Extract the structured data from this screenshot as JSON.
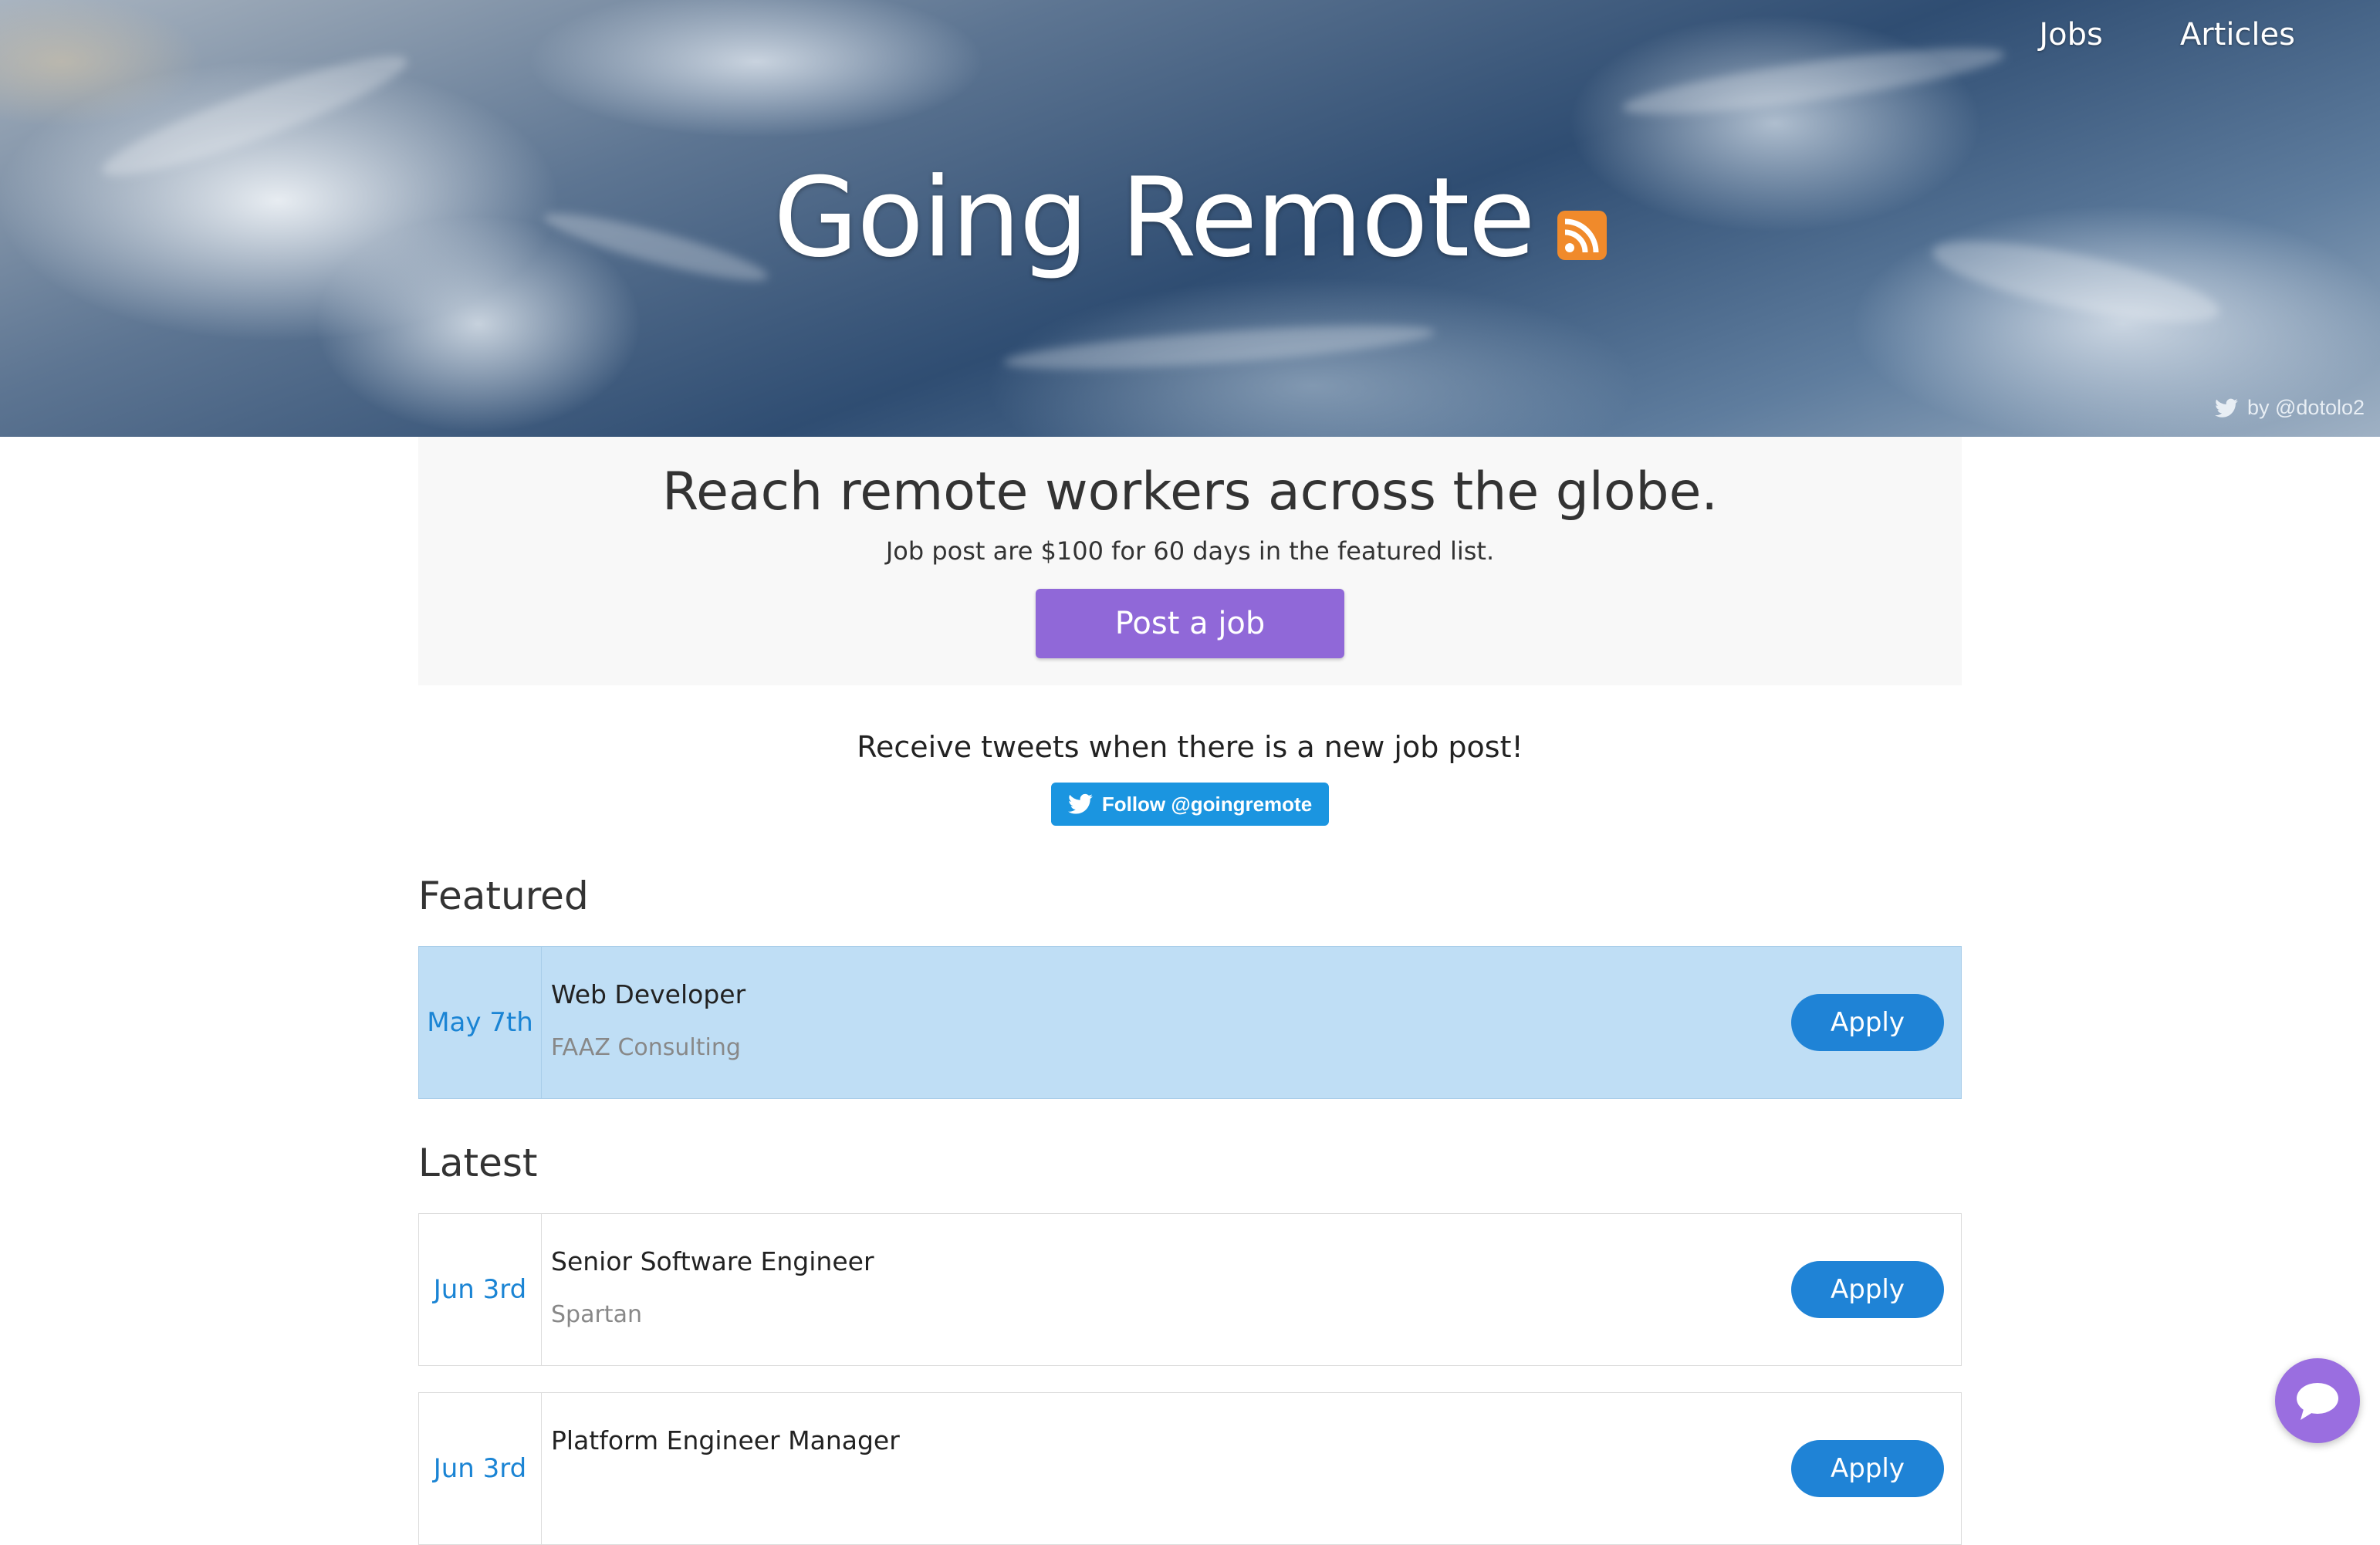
{
  "nav": {
    "items": [
      "Jobs",
      "Articles"
    ]
  },
  "hero": {
    "title": "Going Remote",
    "credit": "by @dotolo2"
  },
  "promo": {
    "heading": "Reach remote workers across the globe.",
    "subtext": "Job post are $100 for 60 days in the featured list.",
    "button": "Post a job"
  },
  "tweets": {
    "text": "Receive tweets when there is a new job post!",
    "button": "Follow @goingremote"
  },
  "featured": {
    "title": "Featured",
    "jobs": [
      {
        "date": "May 7th",
        "title": "Web Developer",
        "company": "FAAZ Consulting",
        "apply": "Apply"
      }
    ]
  },
  "latest": {
    "title": "Latest",
    "jobs": [
      {
        "date": "Jun 3rd",
        "title": "Senior Software Engineer",
        "company": "Spartan",
        "apply": "Apply"
      },
      {
        "date": "Jun 3rd",
        "title": "Platform Engineer Manager",
        "company": "",
        "apply": "Apply"
      }
    ]
  },
  "colors": {
    "accent_purple": "#9068d8",
    "apply_blue": "#1f83d6",
    "featured_bg": "#bfdef5",
    "twitter_blue": "#1b95e0"
  },
  "icons": [
    "rss-icon",
    "twitter-icon",
    "chat-icon"
  ]
}
